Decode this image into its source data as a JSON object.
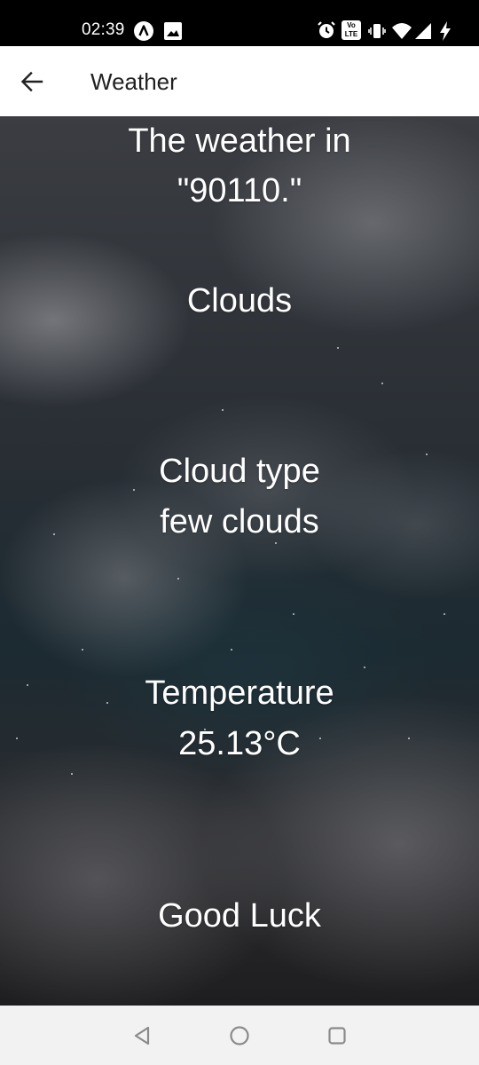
{
  "status_bar": {
    "time": "02:39",
    "left_icons": [
      "app-notification-icon",
      "image-notification-icon"
    ],
    "right_icons": [
      "alarm-icon",
      "volte-icon",
      "vibrate-icon",
      "wifi-icon",
      "signal-icon",
      "battery-charging-icon"
    ],
    "volte_label": "Vo",
    "lte_label": "LTE"
  },
  "app_bar": {
    "back_icon": "arrow-back-icon",
    "title": "Weather"
  },
  "content": {
    "location_line1": "The weather in",
    "location_line2": "\"90110.\"",
    "condition": "Clouds",
    "cloud_type_label": "Cloud type",
    "cloud_type_value": "few clouds",
    "temperature_label": "Temperature",
    "temperature_value": "25.13°C",
    "closing": "Good Luck"
  },
  "nav_bar": {
    "buttons": [
      "back-triangle-icon",
      "home-circle-icon",
      "recents-square-icon"
    ]
  },
  "colors": {
    "status_bar": "#000000",
    "app_bar": "#ffffff",
    "title_text": "#212121",
    "content_text": "#ffffff",
    "nav_bar": "#f2f2f2",
    "nav_icons": "#8a8a8a"
  }
}
